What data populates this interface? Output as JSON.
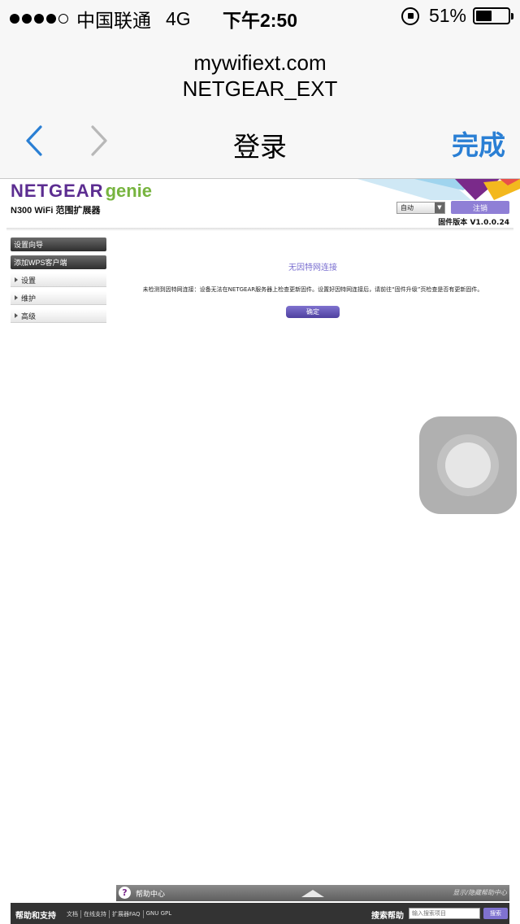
{
  "status_bar": {
    "carrier": "中国联通",
    "network": "4G",
    "time": "下午2:50",
    "battery_percent": "51%",
    "battery_level": 0.51
  },
  "login_sheet": {
    "host": "mywifiext.com",
    "realm": "NETGEAR_EXT",
    "title": "登录",
    "done_label": "完成",
    "accent_color": "#2a7fd4"
  },
  "page": {
    "logo_text": "NETGEAR",
    "logo_suffix": "genie",
    "product": "N300 WiFi 范围扩展器",
    "language_selected": "自动",
    "logout_label": "注销",
    "firmware_label": "固件版本",
    "firmware_version": "V1.0.0.24",
    "menu": {
      "setup_wizard": "设置向导",
      "add_wps_client": "添加WPS客户端",
      "settings": "设置",
      "maintenance": "维护",
      "advanced": "高级"
    },
    "content": {
      "title": "无因特网连接",
      "message": "未检测到因特网连接：设备无法在NETGEAR服务器上检查更新固件。设置好因特网连接后，请前往“固件升级”页检查是否有更新固件。",
      "ok_label": "确定"
    },
    "help": {
      "icon_glyph": "?",
      "label": "帮助中心",
      "toggle": "显示/隐藏帮助中心"
    },
    "footer": {
      "title": "帮助和支持",
      "links": [
        "文档",
        "在线支持",
        "扩展器FAQ",
        "GNU GPL"
      ],
      "search_label": "搜索帮助",
      "search_placeholder": "输入搜索项目",
      "search_button": "搜索"
    }
  }
}
